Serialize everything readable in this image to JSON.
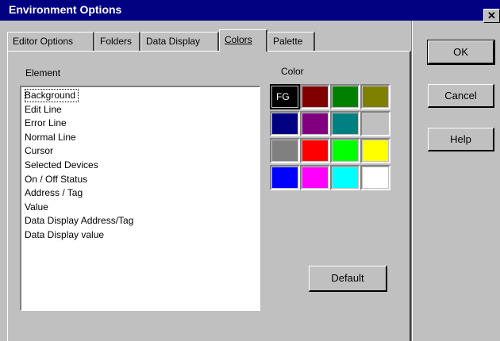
{
  "window": {
    "title": "Environment Options",
    "close_glyph": "✕"
  },
  "tabs": [
    {
      "label": "Editor Options"
    },
    {
      "label": "Folders"
    },
    {
      "label": "Data Display"
    },
    {
      "label": "Colors",
      "active": true
    },
    {
      "label": "Palette"
    }
  ],
  "element_section": {
    "label": "Element",
    "items": [
      "Background",
      "Edit Line",
      "Error Line",
      "Normal Line",
      "Cursor",
      "Selected Devices",
      "On / Off Status",
      "Address / Tag",
      "Value",
      "Data Display Address/Tag",
      "Data Display value"
    ],
    "selected_item": "Background"
  },
  "color_section": {
    "label": "Color",
    "selected_marker": "FG",
    "swatches": [
      "#000000",
      "#800000",
      "#008000",
      "#808000",
      "#000080",
      "#800080",
      "#008080",
      "#c0c0c0",
      "#808080",
      "#ff0000",
      "#00ff00",
      "#ffff00",
      "#0000ff",
      "#ff00ff",
      "#00ffff",
      "#ffffff"
    ]
  },
  "buttons": {
    "ok": "OK",
    "cancel": "Cancel",
    "help": "Help",
    "default": "Default"
  }
}
